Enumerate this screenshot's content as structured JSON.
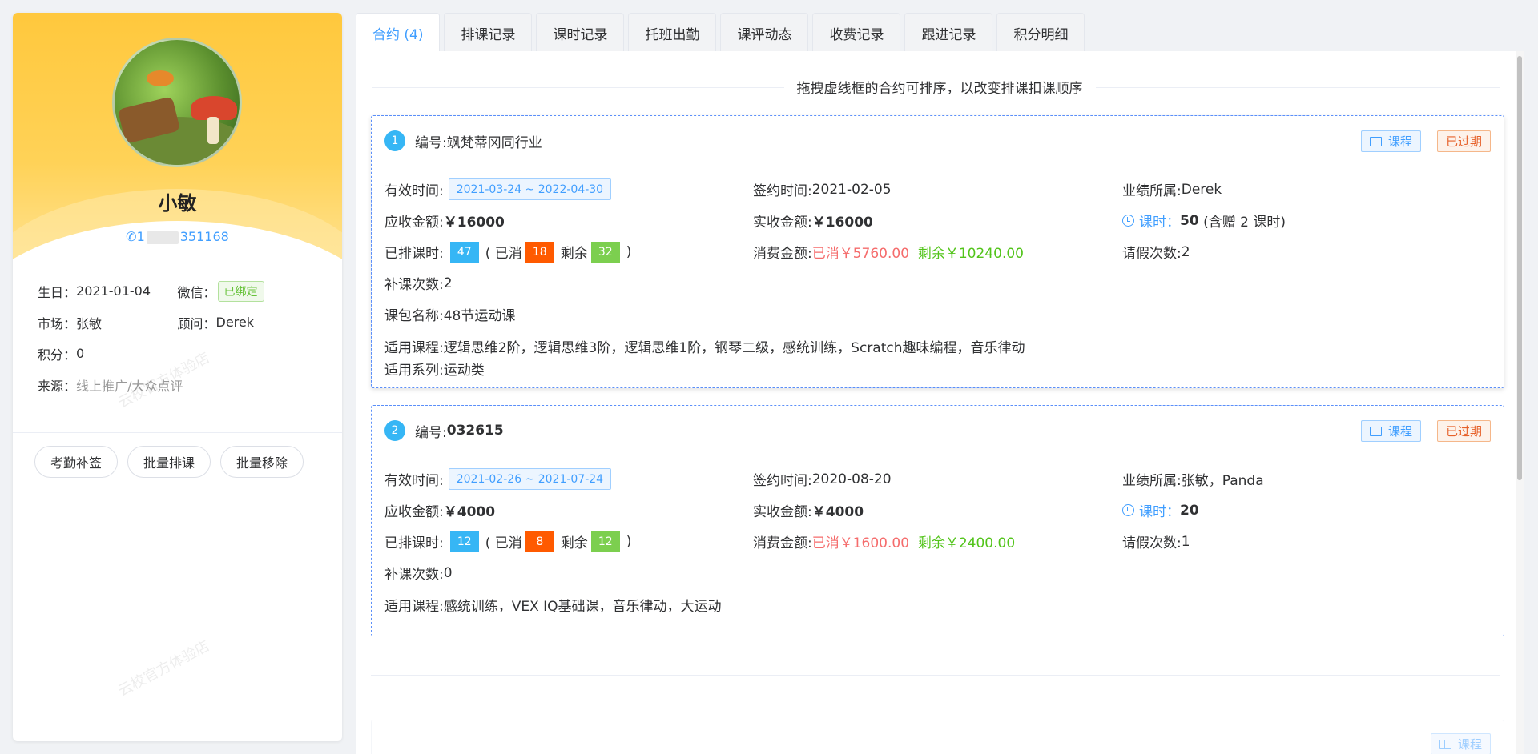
{
  "profile": {
    "name": "小敏",
    "phone_prefix": "1",
    "phone_suffix": "351168",
    "birthday_label": "生日：",
    "birthday": "2021-01-04",
    "wechat_label": "微信：",
    "wechat_status": "已绑定",
    "market_label": "市场：",
    "market": "张敏",
    "advisor_label": "顾问：",
    "advisor": "Derek",
    "points_label": "积分：",
    "points": "0",
    "source_label": "来源：",
    "source": "线上推广/大众点评",
    "actions": [
      "考勤补签",
      "批量排课",
      "批量移除"
    ],
    "watermark": "云校官方体验店"
  },
  "tabs": [
    "合约 (4)",
    "排课记录",
    "课时记录",
    "托班出勤",
    "课评动态",
    "收费记录",
    "跟进记录",
    "积分明细"
  ],
  "hint": "拖拽虚线框的合约可排序，以改变排课扣课顺序",
  "tag_course": "课程",
  "tag_expired": "已过期",
  "labels": {
    "no": "编号: ",
    "valid": "有效时间:",
    "sign": "签约时间: ",
    "perf": "业绩所属: ",
    "due": "应收金额: ",
    "paid": "实收金额: ",
    "hours": "课时",
    "scheduled": "已排课时: ",
    "used": "( 已消",
    "remain": "剩余",
    "close": ")",
    "consume": "消费金额: ",
    "consumed": "已消",
    "left": "剩余",
    "leave": "请假次数: ",
    "makeup": "补课次数: ",
    "package": "课包名称: ",
    "courses": "适用课程: ",
    "series": "适用系列: "
  },
  "contracts": [
    {
      "index": "1",
      "no": "飒梵蒂冈同行业",
      "valid": "2021-03-24 ~ 2022-04-30",
      "sign": "2021-02-05",
      "perf": "Derek",
      "due": "￥16000",
      "paid": "￥16000",
      "hours": "50",
      "hours_gift": "(含赠  2  课时)",
      "scheduled": "47",
      "used": "18",
      "remain": "32",
      "consumed": "￥5760.00",
      "left": "￥10240.00",
      "leave": "2",
      "makeup": "2",
      "package": "48节运动课",
      "courses": "逻辑思维2阶，逻辑思维3阶，逻辑思维1阶，钢琴二级，感统训练，Scratch趣味编程，音乐律动",
      "series": "运动类"
    },
    {
      "index": "2",
      "no": "032615",
      "valid": "2021-02-26 ~ 2021-07-24",
      "sign": "2020-08-20",
      "perf": "张敏，Panda",
      "due": "￥4000",
      "paid": "￥4000",
      "hours": "20",
      "scheduled": "12",
      "used": "8",
      "remain": "12",
      "consumed": "￥1600.00",
      "left": "￥2400.00",
      "leave": "1",
      "makeup": "0",
      "courses": "感统训练，VEX IQ基础课，音乐律动，大运动"
    }
  ]
}
